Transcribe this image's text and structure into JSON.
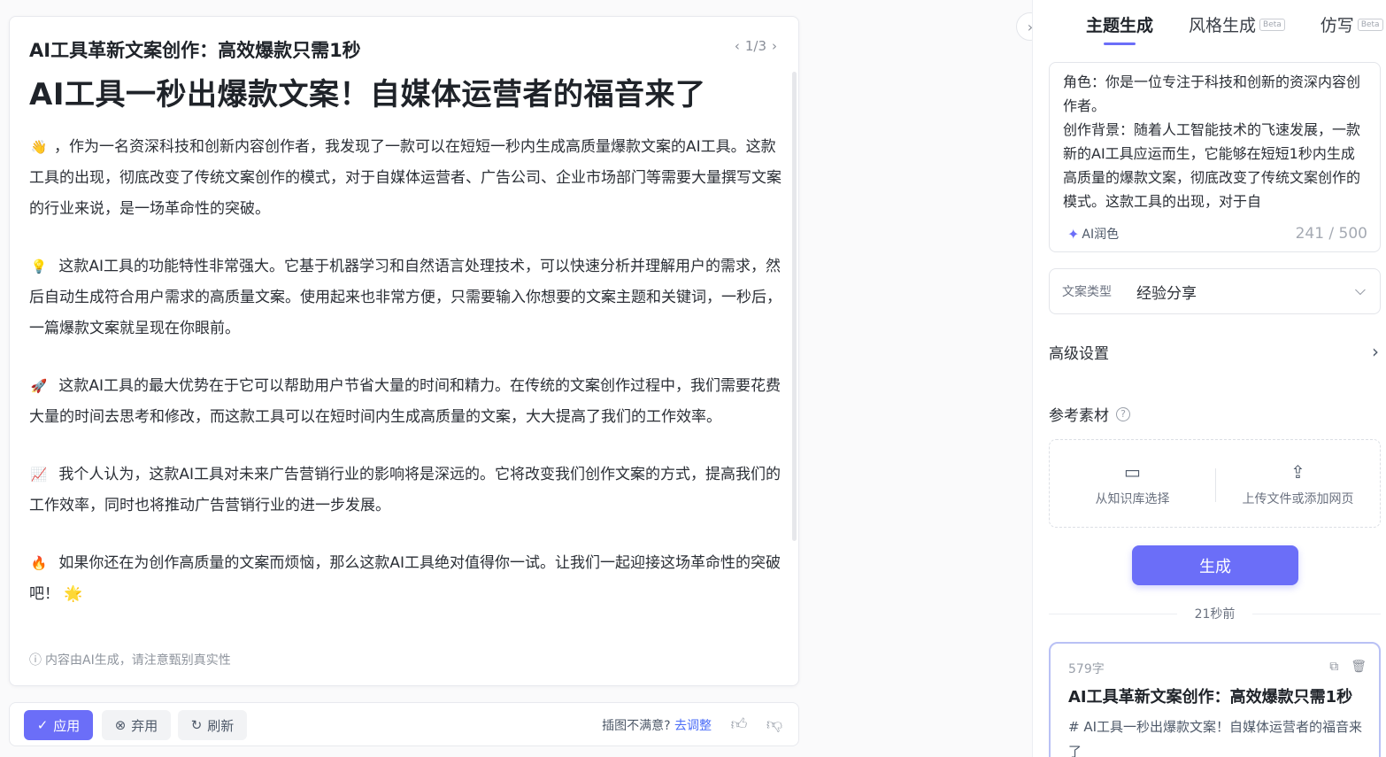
{
  "article": {
    "subtitle": "AI工具革新文案创作：高效爆款只需1秒",
    "pager": "1/3",
    "title": "AI工具一秒出爆款文案！自媒体运营者的福音来了",
    "paragraphs": [
      {
        "emoji": "👋",
        "text": "，作为一名资深科技和创新内容创作者，我发现了一款可以在短短一秒内生成高质量爆款文案的AI工具。这款工具的出现，彻底改变了传统文案创作的模式，对于自媒体运营者、广告公司、企业市场部门等需要大量撰写文案的行业来说，是一场革命性的突破。"
      },
      {
        "emoji": "💡",
        "text": " 这款AI工具的功能特性非常强大。它基于机器学习和自然语言处理技术，可以快速分析并理解用户的需求，然后自动生成符合用户需求的高质量文案。使用起来也非常方便，只需要输入你想要的文案主题和关键词，一秒后，一篇爆款文案就呈现在你眼前。"
      },
      {
        "emoji": "🚀",
        "text": " 这款AI工具的最大优势在于它可以帮助用户节省大量的时间和精力。在传统的文案创作过程中，我们需要花费大量的时间去思考和修改，而这款工具可以在短时间内生成高质量的文案，大大提高了我们的工作效率。"
      },
      {
        "emoji": "📈",
        "text": " 我个人认为，这款AI工具对未来广告营销行业的影响将是深远的。它将改变我们创作文案的方式，提高我们的工作效率，同时也将推动广告营销行业的进一步发展。"
      },
      {
        "emoji": "🔥",
        "text": " 如果你还在为创作高质量的文案而烦恼，那么这款AI工具绝对值得你一试。让我们一起迎接这场革命性的突破吧！ 🌟"
      }
    ],
    "disclaimer": "内容由AI生成，请注意甄别真实性"
  },
  "actions": {
    "apply": "应用",
    "discard": "弃用",
    "refresh": "刷新",
    "feedback_prompt": "插图不满意?",
    "feedback_link": "去调整"
  },
  "panel": {
    "tabs": [
      {
        "label": "主题生成",
        "beta": ""
      },
      {
        "label": "风格生成",
        "beta": "Beta"
      },
      {
        "label": "仿写",
        "beta": "Beta"
      }
    ],
    "prompt_lines": [
      "角色：你是一位专注于科技和创新的资深内容创作者。",
      "创作背景：随着人工智能技术的飞速发展，一款新的AI工具应运而生，它能够在短短1秒内生成高质量的爆款文案，彻底改变了传统文案创作的模式。这款工具的出现，对于自"
    ],
    "polish_label": "AI润色",
    "char_count": "241 / 500",
    "type_label": "文案类型",
    "type_value": "经验分享",
    "advanced_label": "高级设置",
    "reference_label": "参考素材",
    "ref_knowledge": "从知识库选择",
    "ref_upload": "上传文件或添加网页",
    "generate_label": "生成",
    "timestamp": "21秒前",
    "result": {
      "wordcount": "579字",
      "title": "AI工具革新文案创作：高效爆款只需1秒",
      "excerpt": "# AI工具一秒出爆款文案！自媒体运营者的福音来了"
    }
  },
  "colors": {
    "accent": "#6b6ef8",
    "link": "#4a6cf7"
  }
}
